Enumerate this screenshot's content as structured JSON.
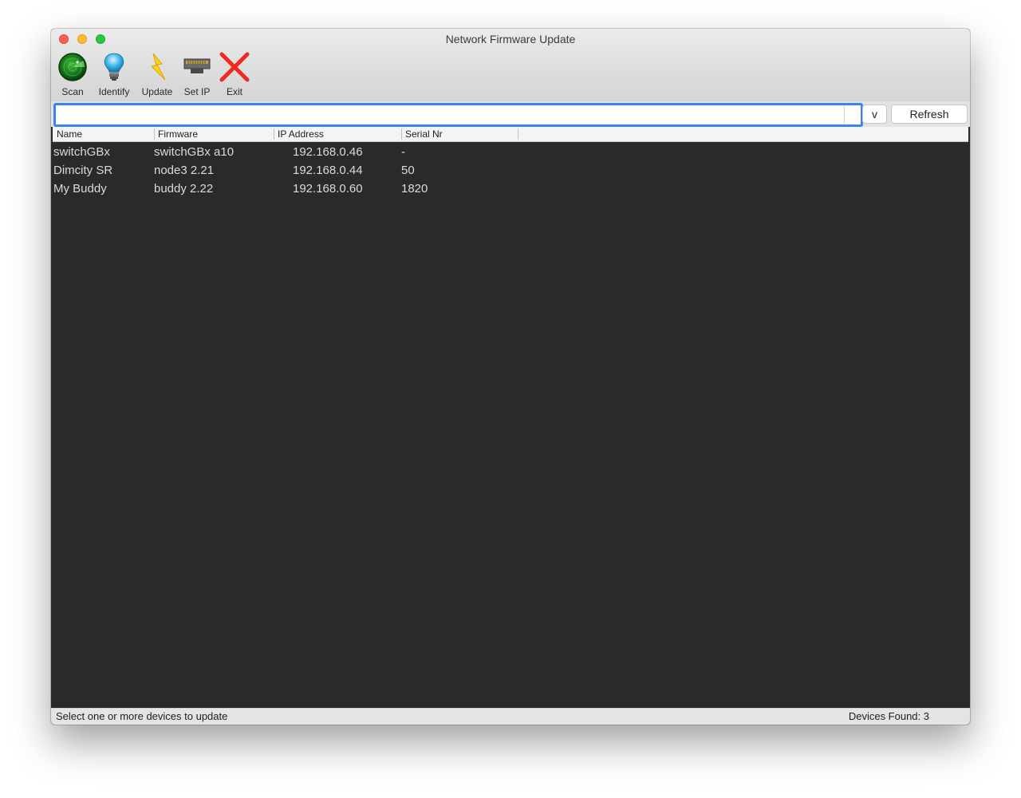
{
  "window": {
    "title": "Network Firmware Update"
  },
  "toolbar": {
    "items": [
      {
        "label": "Scan",
        "icon": "radar-icon"
      },
      {
        "label": "Identify",
        "icon": "lightbulb-icon"
      },
      {
        "label": "Update",
        "icon": "lightning-icon"
      },
      {
        "label": "Set IP",
        "icon": "network-port-icon"
      },
      {
        "label": "Exit",
        "icon": "close-icon"
      }
    ]
  },
  "search": {
    "value": "",
    "placeholder": ""
  },
  "buttons": {
    "dropdown_label": "v",
    "refresh_label": "Refresh"
  },
  "table": {
    "columns": [
      "Name",
      "Firmware",
      "IP Address",
      "Serial Nr"
    ],
    "rows": [
      {
        "name": "switchGBx",
        "firmware": "switchGBx a10",
        "ip": "192.168.0.46",
        "serial": "-"
      },
      {
        "name": "Dimcity SR",
        "firmware": "node3 2.21",
        "ip": "192.168.0.44",
        "serial": "50"
      },
      {
        "name": "My Buddy",
        "firmware": "buddy 2.22",
        "ip": "192.168.0.60",
        "serial": "1820"
      }
    ]
  },
  "status": {
    "message": "Select one or more devices to update",
    "devices_found": "Devices Found: 3"
  },
  "colors": {
    "focus_ring": "#3a84f0",
    "table_background": "#2a2a2a",
    "close_red": "#fc5f57",
    "minimize_yellow": "#fdbb2e",
    "maximize_green": "#28c840"
  }
}
